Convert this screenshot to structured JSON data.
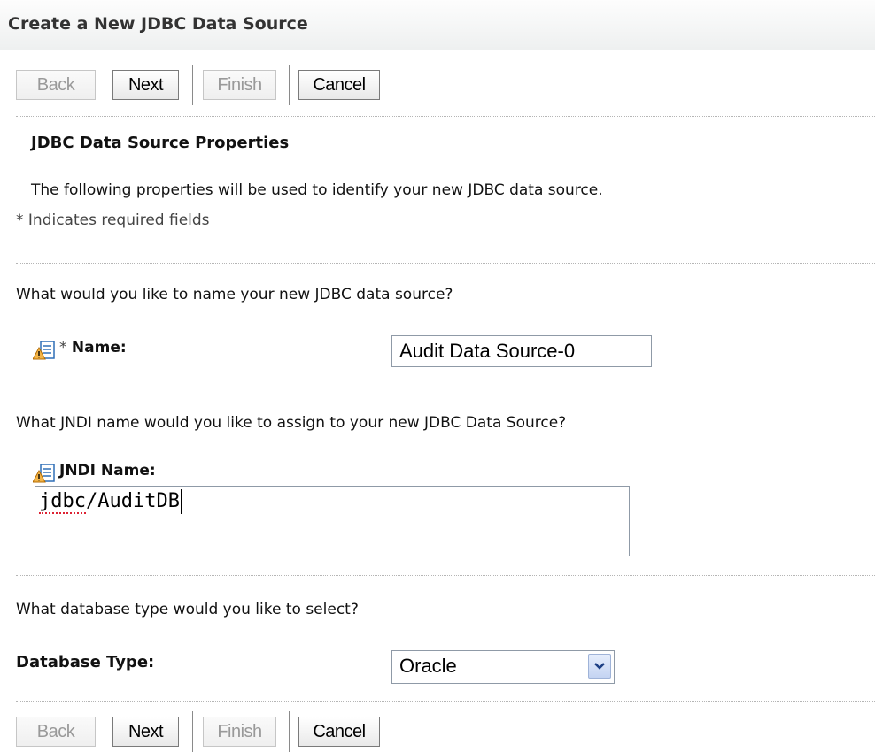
{
  "header": {
    "title": "Create a New JDBC Data Source"
  },
  "buttons": {
    "back": "Back",
    "next": "Next",
    "finish": "Finish",
    "cancel": "Cancel"
  },
  "section": {
    "heading": "JDBC Data Source Properties",
    "description": "The following properties will be used to identify your new JDBC data source.",
    "required_note": "* Indicates required fields"
  },
  "name_field": {
    "question": "What would you like to name your new JDBC data source?",
    "required_mark": "*",
    "label": "Name:",
    "value": "Audit Data Source-0"
  },
  "jndi_field": {
    "question": "What JNDI name would you like to assign to your new JDBC Data Source?",
    "label": "JNDI Name:",
    "value_underlined": "jdbc",
    "value_rest": "/AuditDB"
  },
  "db_type_field": {
    "question": "What database type would you like to select?",
    "label": "Database Type:",
    "selected": "Oracle"
  },
  "colors": {
    "title_text": "#333333",
    "border": "#8f9aa7",
    "icon_warning": "#e8a33c",
    "icon_blue": "#2f6fb7"
  },
  "icons": {
    "field_help": "warning-form-icon",
    "select_arrow": "chevron-down-icon"
  }
}
